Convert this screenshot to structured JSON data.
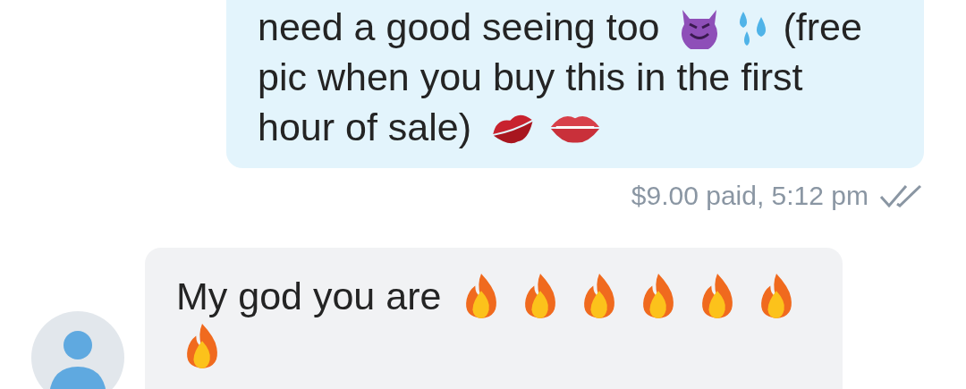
{
  "messages": [
    {
      "kind": "outgoing",
      "lines": [
        [
          {
            "kind": "text",
            "text": "need a good seeing too"
          },
          {
            "kind": "devil"
          },
          {
            "kind": "droplets"
          },
          {
            "kind": "text",
            "text": "(free"
          }
        ],
        [
          {
            "kind": "text",
            "text": "pic when you buy this in the first"
          }
        ],
        [
          {
            "kind": "text",
            "text": "hour of sale)"
          },
          {
            "kind": "kiss"
          },
          {
            "kind": "lips"
          }
        ]
      ],
      "meta": "$9.00 paid, 5:12 pm",
      "read": true
    },
    {
      "kind": "incoming",
      "lines": [
        [
          {
            "kind": "text",
            "text": "My god you are"
          },
          {
            "kind": "fire"
          },
          {
            "kind": "fire"
          },
          {
            "kind": "fire"
          },
          {
            "kind": "fire"
          },
          {
            "kind": "fire"
          },
          {
            "kind": "fire"
          }
        ],
        [
          {
            "kind": "fire"
          }
        ]
      ]
    }
  ]
}
